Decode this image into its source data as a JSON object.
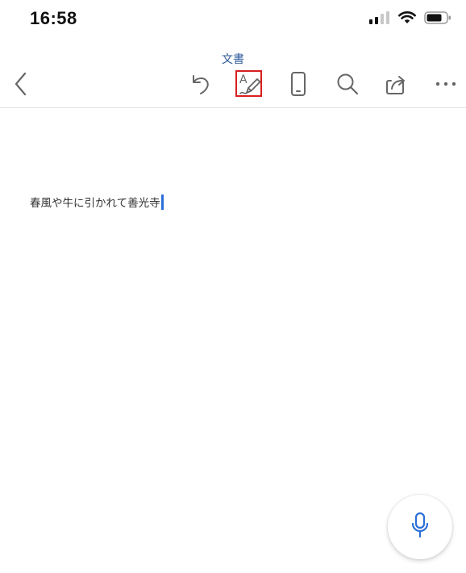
{
  "status_bar": {
    "time": "16:58",
    "icons": [
      "cellular-signal-icon",
      "wifi-icon",
      "battery-icon"
    ]
  },
  "toolbar": {
    "title": "文書",
    "buttons": [
      {
        "name": "back-button",
        "icon": "chevron-left-icon"
      },
      {
        "name": "undo-button",
        "icon": "undo-icon"
      },
      {
        "name": "draw-button",
        "icon": "draw-pen-icon",
        "highlighted": true
      },
      {
        "name": "mobile-view-button",
        "icon": "phone-icon"
      },
      {
        "name": "search-button",
        "icon": "search-icon"
      },
      {
        "name": "share-button",
        "icon": "share-icon"
      },
      {
        "name": "more-button",
        "icon": "ellipsis-icon"
      }
    ]
  },
  "document": {
    "text": "春風や牛に引かれて善光寺"
  },
  "mic_button": {
    "icon": "microphone-icon"
  },
  "colors": {
    "accent": "#2b579a",
    "cursor": "#2b6fd6",
    "highlight": "#d81e1e",
    "icon": "#666666"
  }
}
